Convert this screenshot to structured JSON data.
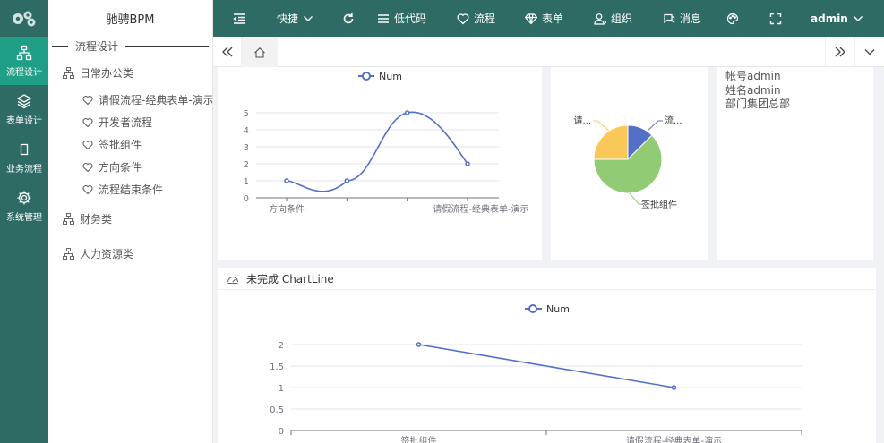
{
  "app": {
    "title": "驰骋BPM"
  },
  "rail": [
    {
      "label": "流程设计",
      "icon": "org-chart-icon",
      "active": true
    },
    {
      "label": "表单设计",
      "icon": "layers-icon",
      "active": false
    },
    {
      "label": "业务流程",
      "icon": "square-icon",
      "active": false
    },
    {
      "label": "系统管理",
      "icon": "gear-icon",
      "active": false
    }
  ],
  "sidebar": {
    "section_title": "流程设计",
    "groups": [
      {
        "label": "日常办公类",
        "items": [
          "请假流程-经典表单-演示",
          "开发者流程",
          "签批组件",
          "方向条件",
          "流程结束条件"
        ]
      },
      {
        "label": "财务类",
        "items": []
      },
      {
        "label": "人力资源类",
        "items": []
      }
    ]
  },
  "topbar": {
    "quick": "快捷",
    "lowcode": "低代码",
    "flow": "流程",
    "form": "表单",
    "org": "组织",
    "msg": "消息",
    "user": "admin"
  },
  "user_card": {
    "account_label": "帐号",
    "account": "admin",
    "name_label": "姓名",
    "name": "admin",
    "dept_label": "部门",
    "dept": "集团总部"
  },
  "chart_data": [
    {
      "type": "line",
      "smooth": true,
      "legend": "Num",
      "categories": [
        "方向条件",
        "",
        "",
        "请假流程-经典表单-演示"
      ],
      "tick_labels_shown": [
        "方向条件",
        "请假流程-经典表单-演示"
      ],
      "values": [
        1,
        1,
        5,
        2
      ],
      "ylim": [
        0,
        5
      ],
      "yticks": [
        0,
        1,
        2,
        3,
        4,
        5
      ],
      "color": "#5470c6"
    },
    {
      "type": "pie",
      "slices": [
        {
          "label": "流...",
          "value": 1,
          "color": "#5470c6"
        },
        {
          "label": "签批组件",
          "value": 5,
          "color": "#91cc75"
        },
        {
          "label": "请...",
          "value": 2,
          "color": "#fac858"
        }
      ]
    },
    {
      "type": "line",
      "title": "未完成 ChartLine",
      "legend": "Num",
      "categories": [
        "签批组件",
        "请假流程-经典表单-演示"
      ],
      "values": [
        2,
        1
      ],
      "ylim": [
        0,
        2
      ],
      "yticks": [
        "0",
        "0.5",
        "1",
        "1.5",
        "2"
      ],
      "color": "#5470c6"
    }
  ]
}
